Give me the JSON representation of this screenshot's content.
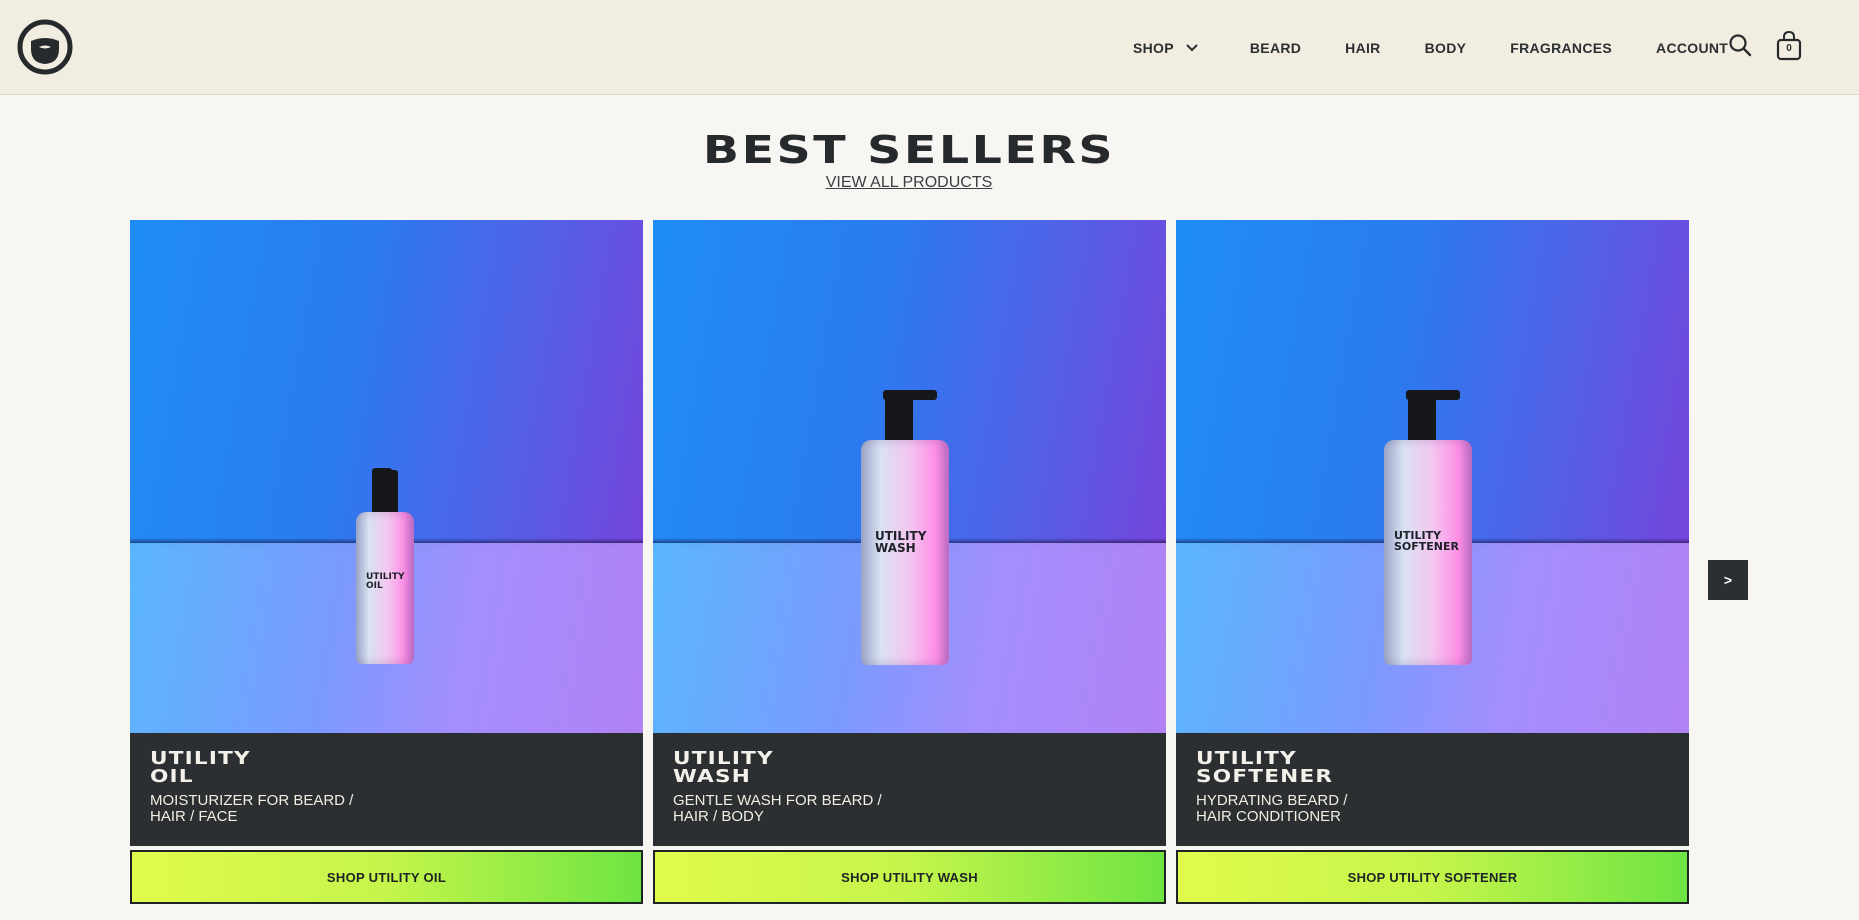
{
  "header": {
    "logo_icon": "beard-logo-icon",
    "nav": {
      "shop": "SHOP",
      "beard": "BEARD",
      "hair": "HAIR",
      "body": "BODY",
      "fragrances": "FRAGRANCES",
      "account": "ACCOUNT"
    },
    "cart_count": "0"
  },
  "section": {
    "title": "BEST SELLERS",
    "view_all": "VIEW ALL PRODUCTS"
  },
  "products": [
    {
      "name": "UTILITY\nOIL",
      "description": "MOISTURIZER FOR BEARD /\nHAIR / FACE",
      "cta": "SHOP UTILITY OIL",
      "bottle_label": "UTILITY\nOIL"
    },
    {
      "name": "UTILITY\nWASH",
      "description": "GENTLE WASH FOR BEARD /\nHAIR / BODY",
      "cta": "SHOP UTILITY WASH",
      "bottle_label": "UTILITY\nWASH"
    },
    {
      "name": "UTILITY\nSOFTENER",
      "description": "HYDRATING BEARD /\nHAIR CONDITIONER",
      "cta": "SHOP UTILITY SOFTENER",
      "bottle_label": "UTILITY\nSOFTENER"
    }
  ],
  "carousel": {
    "next_label": ">"
  },
  "colors": {
    "header_bg": "#f1ede1",
    "page_bg": "#f7f6f3",
    "card_info_bg": "#2b2f31",
    "cta_gradient_start": "#e1fb4c",
    "cta_gradient_end": "#6ee442"
  }
}
